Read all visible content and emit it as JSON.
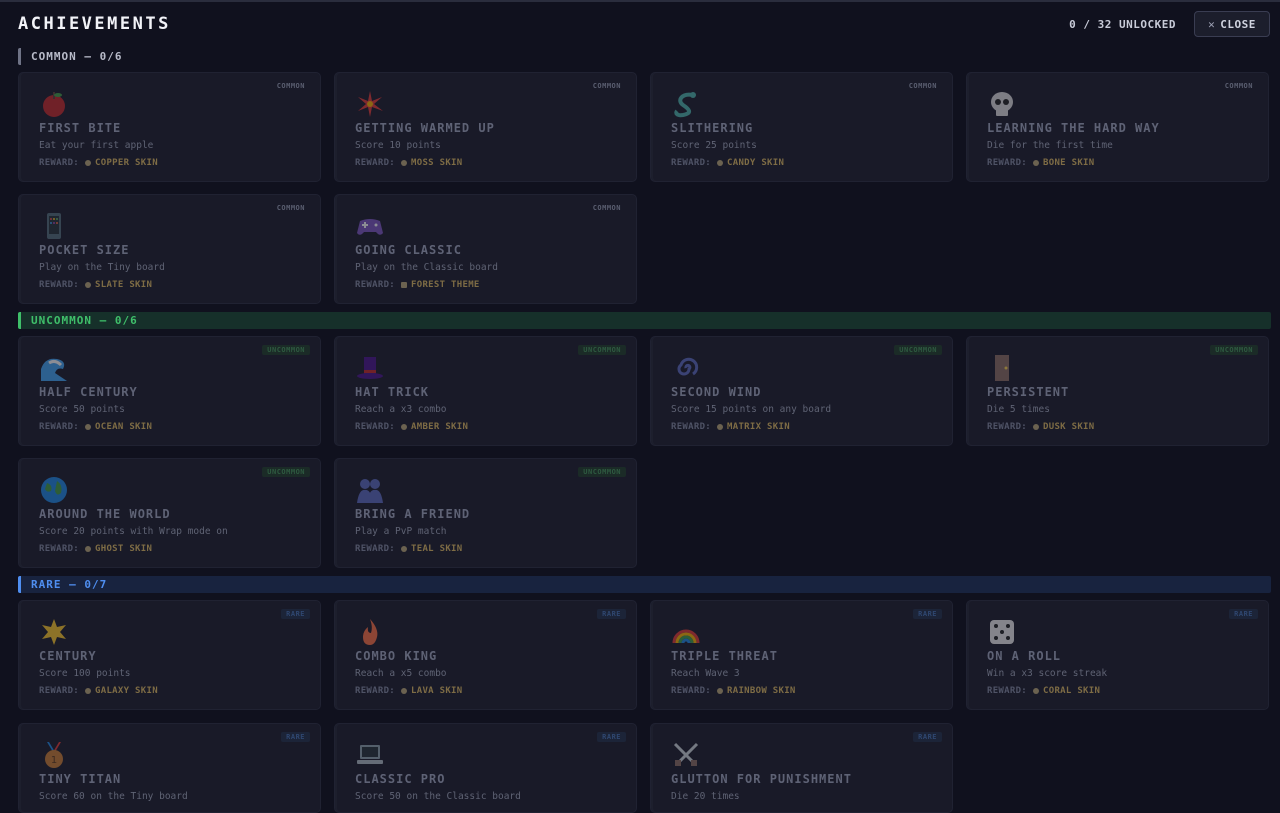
{
  "header": {
    "title": "ACHIEVEMENTS",
    "unlocked": "0 / 32 UNLOCKED",
    "close_label": "CLOSE"
  },
  "reward_prefix": "REWARD:",
  "sections": {
    "common": {
      "label": "COMMON — 0/6",
      "color": "#6f7386"
    },
    "uncommon": {
      "label": "UNCOMMON — 0/6",
      "color": "#3fbf6a"
    },
    "rare": {
      "label": "RARE — 0/7",
      "color": "#4f8ef0"
    }
  },
  "cards": [
    {
      "rarity": "COMMON",
      "name": "FIRST BITE",
      "desc": "Eat your first apple",
      "reward": "COPPER SKIN",
      "icon": "apple-icon"
    },
    {
      "rarity": "COMMON",
      "name": "GETTING WARMED UP",
      "desc": "Score 10 points",
      "reward": "MOSS SKIN",
      "icon": "spark-icon"
    },
    {
      "rarity": "COMMON",
      "name": "SLITHERING",
      "desc": "Score 25 points",
      "reward": "CANDY SKIN",
      "icon": "snake-icon"
    },
    {
      "rarity": "COMMON",
      "name": "LEARNING THE HARD WAY",
      "desc": "Die for the first time",
      "reward": "BONE SKIN",
      "icon": "skull-icon"
    },
    {
      "rarity": "COMMON",
      "name": "POCKET SIZE",
      "desc": "Play on the Tiny board",
      "reward": "SLATE SKIN",
      "icon": "phone-icon"
    },
    {
      "rarity": "COMMON",
      "name": "GOING CLASSIC",
      "desc": "Play on the Classic board",
      "reward": "FOREST THEME",
      "icon": "gamepad-icon"
    },
    {
      "rarity": "UNCOMMON",
      "name": "HALF CENTURY",
      "desc": "Score 50 points",
      "reward": "OCEAN SKIN",
      "icon": "wave-icon"
    },
    {
      "rarity": "UNCOMMON",
      "name": "HAT TRICK",
      "desc": "Reach a x3 combo",
      "reward": "AMBER SKIN",
      "icon": "top-hat-icon"
    },
    {
      "rarity": "UNCOMMON",
      "name": "SECOND WIND",
      "desc": "Score 15 points on any board",
      "reward": "MATRIX SKIN",
      "icon": "swirl-icon"
    },
    {
      "rarity": "UNCOMMON",
      "name": "PERSISTENT",
      "desc": "Die 5 times",
      "reward": "DUSK SKIN",
      "icon": "door-icon"
    },
    {
      "rarity": "UNCOMMON",
      "name": "AROUND THE WORLD",
      "desc": "Score 20 points with Wrap mode on",
      "reward": "GHOST SKIN",
      "icon": "globe-icon"
    },
    {
      "rarity": "UNCOMMON",
      "name": "BRING A FRIEND",
      "desc": "Play a PvP match",
      "reward": "TEAL SKIN",
      "icon": "people-icon"
    },
    {
      "rarity": "RARE",
      "name": "CENTURY",
      "desc": "Score 100 points",
      "reward": "GALAXY SKIN",
      "icon": "star-icon"
    },
    {
      "rarity": "RARE",
      "name": "COMBO KING",
      "desc": "Reach a x5 combo",
      "reward": "LAVA SKIN",
      "icon": "flame-icon"
    },
    {
      "rarity": "RARE",
      "name": "TRIPLE THREAT",
      "desc": "Reach Wave 3",
      "reward": "RAINBOW SKIN",
      "icon": "rainbow-icon"
    },
    {
      "rarity": "RARE",
      "name": "ON A ROLL",
      "desc": "Win a x3 score streak",
      "reward": "CORAL SKIN",
      "icon": "dice-icon"
    },
    {
      "rarity": "RARE",
      "name": "TINY TITAN",
      "desc": "Score 60 on the Tiny board",
      "reward": "",
      "icon": "medal-icon"
    },
    {
      "rarity": "RARE",
      "name": "CLASSIC PRO",
      "desc": "Score 50 on the Classic board",
      "reward": "",
      "icon": "laptop-icon"
    },
    {
      "rarity": "RARE",
      "name": "GLUTTON FOR PUNISHMENT",
      "desc": "Die 20 times",
      "reward": "",
      "icon": "crossed-swords-icon"
    }
  ]
}
